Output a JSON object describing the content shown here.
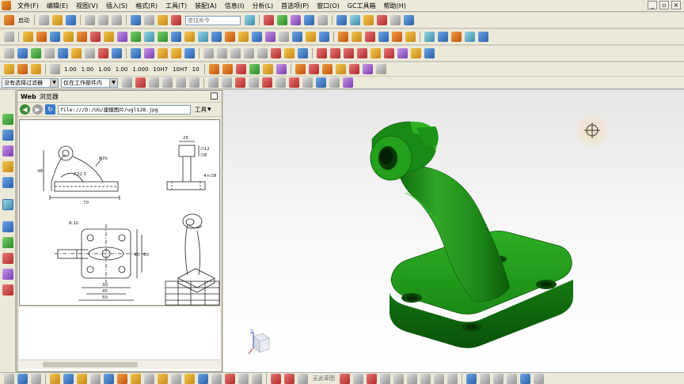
{
  "menu": {
    "items": [
      "文件(F)",
      "编辑(E)",
      "视图(V)",
      "插入(S)",
      "格式(R)",
      "工具(T)",
      "装配(A)",
      "信息(I)",
      "分析(L)",
      "首选项(P)",
      "窗口(O)",
      "GC工具箱",
      "帮助(H)"
    ]
  },
  "toolbar1": {
    "start_label": "启动",
    "command_search_placeholder": "查找命令"
  },
  "toolbar4": {
    "buttons": [
      "1.00",
      "1.00",
      "1.00",
      "1.00",
      "1.000",
      "10H7",
      "10H7",
      "10"
    ]
  },
  "selection_bar": {
    "filter_value": "没有选择过滤器",
    "scope_value": "仅在工作部件内"
  },
  "web_browser": {
    "title_prefix": "Web",
    "title": "浏览器",
    "url": "file:///D:/UG/建模图片/ugl128.jpg",
    "tools_menu": "工具"
  },
  "drawing": {
    "dims": [
      "R32.5",
      "R7b",
      "48",
      "70",
      "25",
      "∅12",
      "∅8",
      "4×∅8",
      "R.10",
      "30",
      "45",
      "50",
      "60",
      "40"
    ]
  },
  "statusbar": {
    "sketch_label": "无此草图"
  },
  "colors": {
    "model_green": "#1f8a1a",
    "ui_background": "#ece9d8",
    "viewport_top": "#e6e6e6"
  }
}
